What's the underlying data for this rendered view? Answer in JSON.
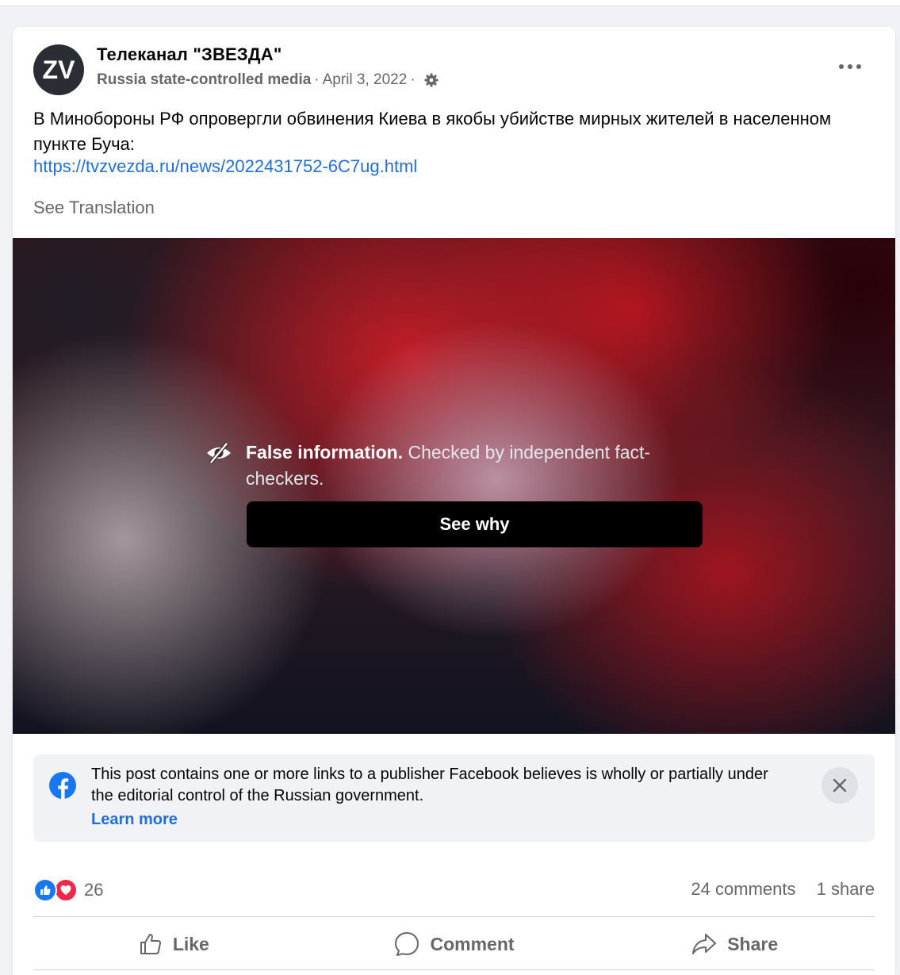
{
  "post": {
    "page_name": "Телеканал \"ЗВЕЗДА\"",
    "avatar_text": "ZV",
    "label": "Russia state-controlled media",
    "separator": "·",
    "date": "April 3, 2022",
    "more_icon": "more-horizontal-icon",
    "privacy_icon": "gear-icon",
    "text": "В Минобороны РФ опровергли обвинения Киева в якобы убийстве мирных жителей в населенном пункте Буча:",
    "link": "https://tvzvezda.ru/news/2022431752-6C7ug.html",
    "see_translation": "See Translation"
  },
  "fact_check": {
    "icon": "eye-slash-icon",
    "title": "False information.",
    "description": "Checked by independent fact-checkers.",
    "button_label": "See why"
  },
  "notice": {
    "icon": "facebook-logo-icon",
    "text": "This post contains one or more links to a publisher Facebook believes is wholly or partially under the editorial control of the Russian government.",
    "learn_more": "Learn more",
    "close_icon": "close-icon"
  },
  "engagement": {
    "reaction_count": "26",
    "comments": "24 comments",
    "shares": "1 share"
  },
  "actions": {
    "like": "Like",
    "comment": "Comment",
    "share": "Share"
  },
  "colors": {
    "link": "#216fdb",
    "like_blue": "#1877f2",
    "love_red": "#f02849",
    "secondary_text": "#65676b"
  }
}
